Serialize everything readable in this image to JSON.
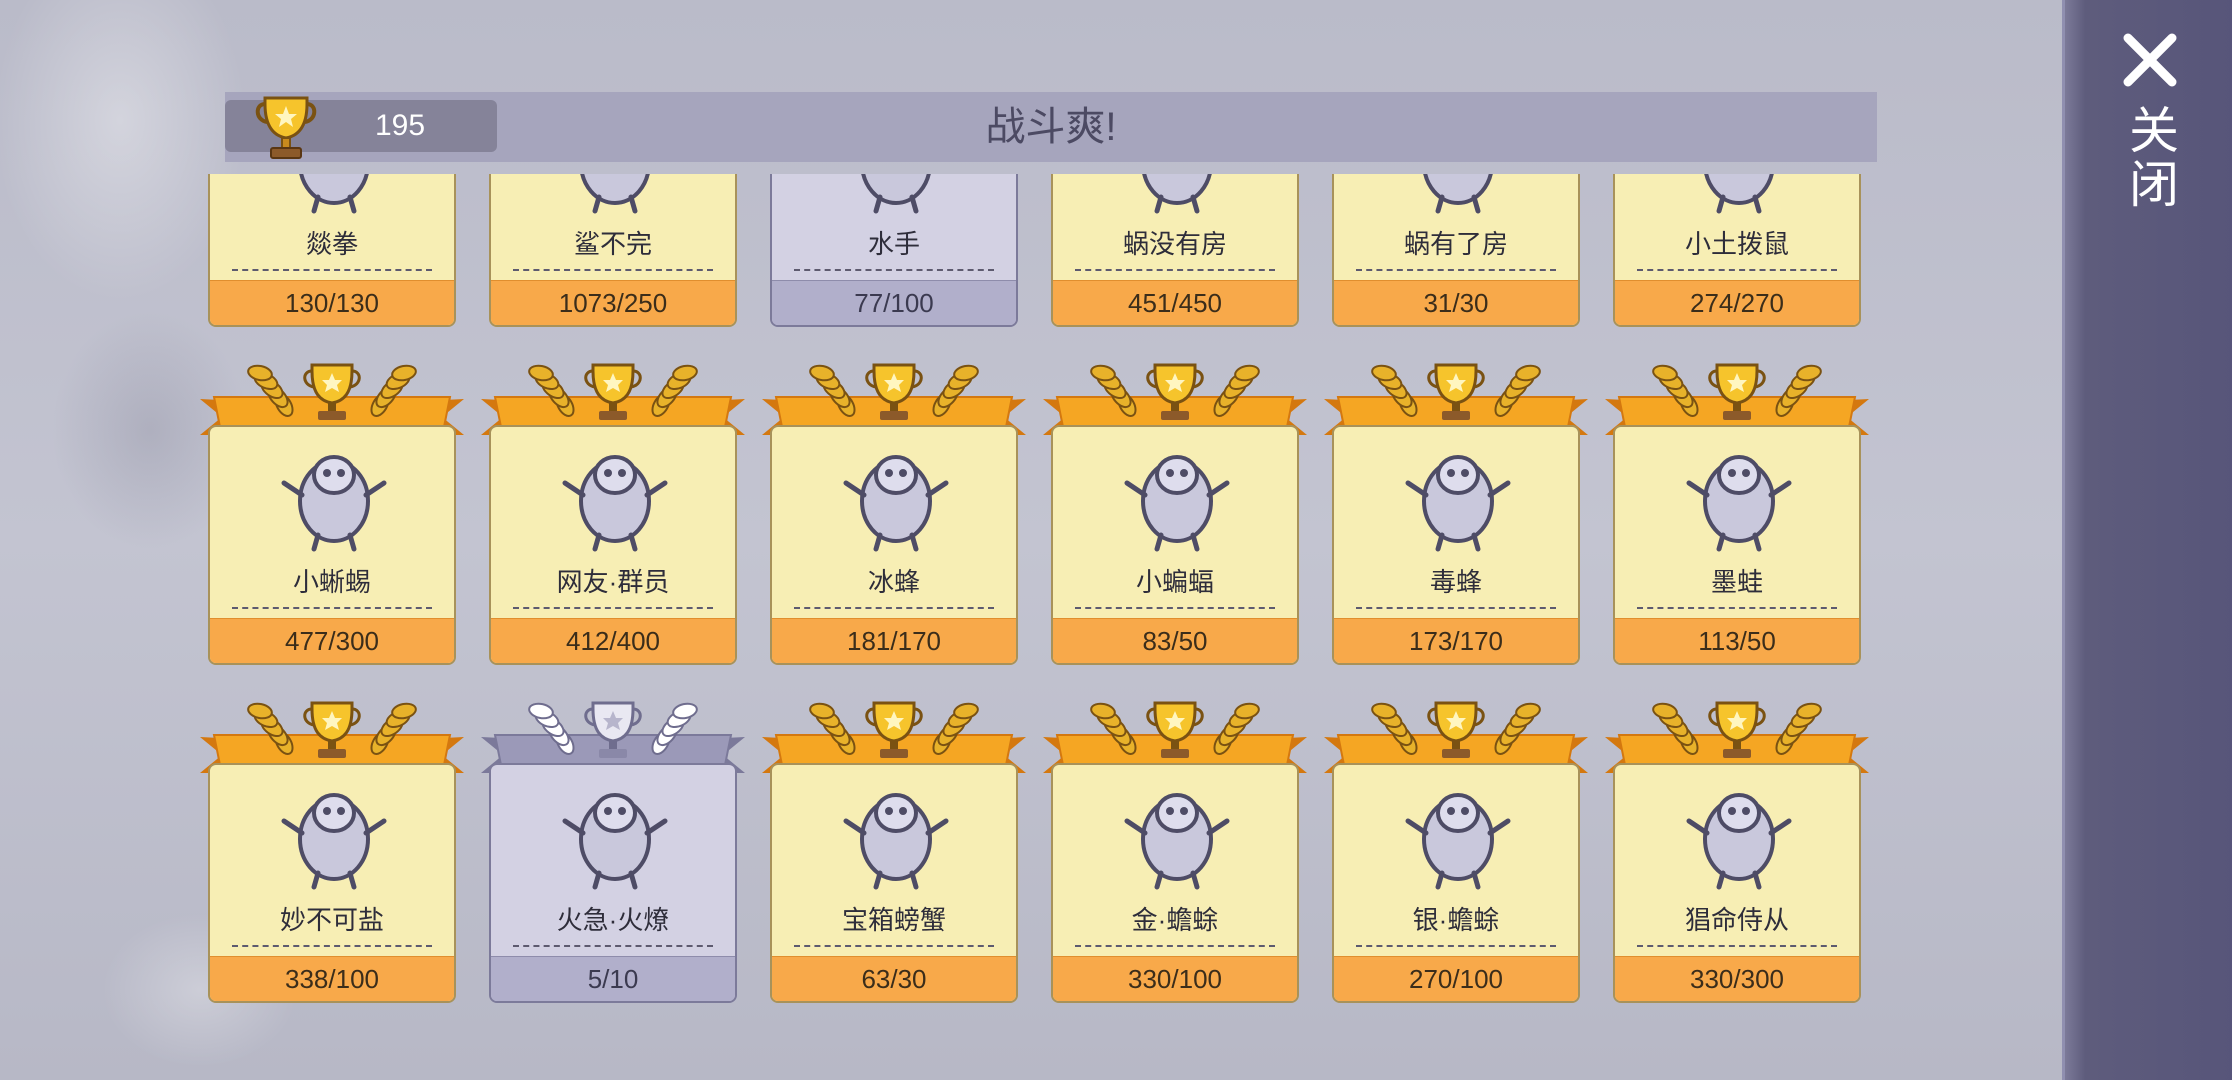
{
  "header": {
    "score": "195",
    "title": "战斗爽!",
    "trophy_icon": "gold-trophy-icon"
  },
  "close": {
    "label": "关闭",
    "icon": "close-x-icon"
  },
  "colors": {
    "gold_ribbon": "#f5a623",
    "gold_card": "#f7eeb4",
    "gold_progress": "#f8a94a",
    "silver_ribbon": "#9b99b8",
    "silver_card": "#d3d1e3",
    "silver_progress": "#b1afcb",
    "header_bar": "#a6a5bd",
    "side_panel": "#5a587c"
  },
  "rows": [
    {
      "cards": [
        {
          "name": "燚拳",
          "progress": "130/130",
          "tier": "gold",
          "icon": "flame-fist-creature-icon"
        },
        {
          "name": "鲨不完",
          "progress": "1073/250",
          "tier": "gold",
          "icon": "shark-beast-creature-icon"
        },
        {
          "name": "水手",
          "progress": "77/100",
          "tier": "silver",
          "icon": "sailor-crab-creature-icon"
        },
        {
          "name": "蜗没有房",
          "progress": "451/450",
          "tier": "gold",
          "icon": "slug-creature-icon"
        },
        {
          "name": "蜗有了房",
          "progress": "31/30",
          "tier": "gold",
          "icon": "snail-creature-icon"
        },
        {
          "name": "小土拨鼠",
          "progress": "274/270",
          "tier": "gold",
          "icon": "groundhog-creature-icon"
        }
      ]
    },
    {
      "cards": [
        {
          "name": "小蜥蜴",
          "progress": "477/300",
          "tier": "gold",
          "icon": "lizard-creature-icon"
        },
        {
          "name": "网友·群员",
          "progress": "412/400",
          "tier": "gold",
          "icon": "spider-creature-icon"
        },
        {
          "name": "冰蜂",
          "progress": "181/170",
          "tier": "gold",
          "icon": "ice-bee-creature-icon"
        },
        {
          "name": "小蝙蝠",
          "progress": "83/50",
          "tier": "gold",
          "icon": "bat-creature-icon"
        },
        {
          "name": "毒蜂",
          "progress": "173/170",
          "tier": "gold",
          "icon": "poison-bee-creature-icon"
        },
        {
          "name": "墨蛙",
          "progress": "113/50",
          "tier": "gold",
          "icon": "ink-frog-creature-icon"
        }
      ]
    },
    {
      "cards": [
        {
          "name": "妙不可盐",
          "progress": "338/100",
          "tier": "gold",
          "icon": "salt-golem-creature-icon"
        },
        {
          "name": "火急·火燎",
          "progress": "5/10",
          "tier": "silver",
          "icon": "fire-bird-creature-icon"
        },
        {
          "name": "宝箱螃蟹",
          "progress": "63/30",
          "tier": "gold",
          "icon": "chest-crab-creature-icon"
        },
        {
          "name": "金·蟾蜍",
          "progress": "330/100",
          "tier": "gold",
          "icon": "gold-toad-creature-icon"
        },
        {
          "name": "银·蟾蜍",
          "progress": "270/100",
          "tier": "gold",
          "icon": "silver-toad-creature-icon"
        },
        {
          "name": "猖命侍从",
          "progress": "330/300",
          "tier": "gold",
          "icon": "feather-servant-creature-icon"
        }
      ]
    }
  ]
}
